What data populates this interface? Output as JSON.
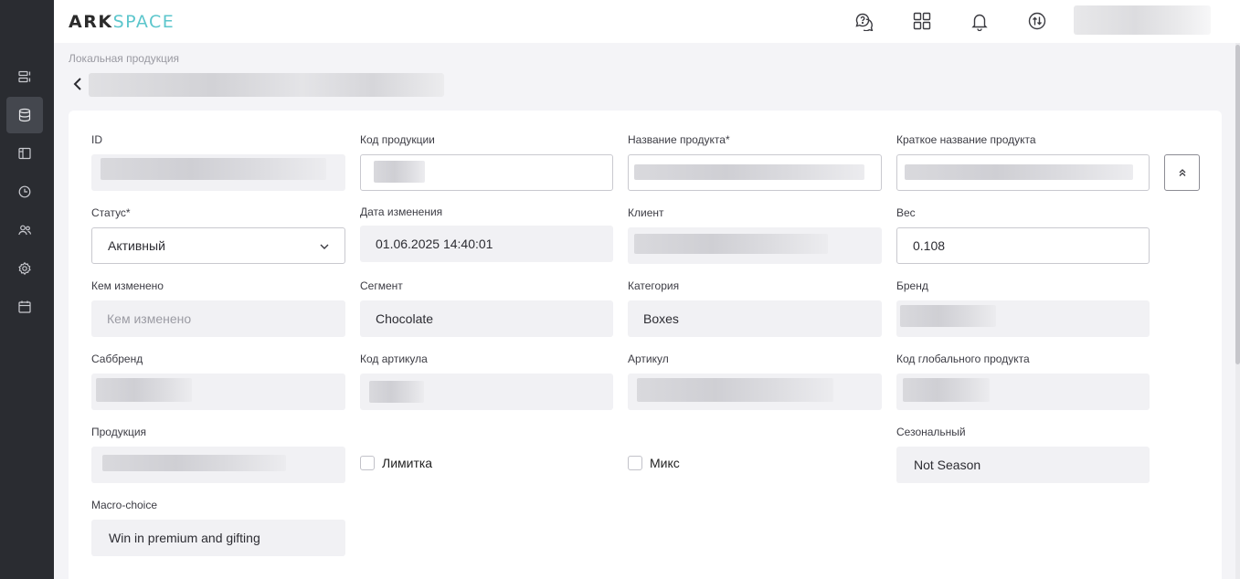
{
  "app": {
    "logo_bold": "ARK",
    "logo_light": "SPACE"
  },
  "nav": {
    "items": [
      {
        "icon": "list-icon"
      },
      {
        "icon": "database-icon",
        "active": true
      },
      {
        "icon": "layout-icon"
      },
      {
        "icon": "clock-icon"
      },
      {
        "icon": "users-icon"
      },
      {
        "icon": "gear-icon"
      },
      {
        "icon": "calendar-icon"
      }
    ]
  },
  "header": {
    "icons": [
      "help-chat-icon",
      "apps-grid-icon",
      "bell-icon",
      "sync-icon"
    ]
  },
  "breadcrumb": "Локальная продукция",
  "form": {
    "id": {
      "label": "ID"
    },
    "product_code": {
      "label": "Код продукции"
    },
    "product_name": {
      "label": "Название продукта*"
    },
    "short_name": {
      "label": "Краткое название продукта"
    },
    "status": {
      "label": "Статус*",
      "value": "Активный"
    },
    "changed_date": {
      "label": "Дата изменения",
      "value": "01.06.2025 14:40:01"
    },
    "client": {
      "label": "Клиент"
    },
    "weight": {
      "label": "Вес",
      "value": "0.108"
    },
    "changed_by": {
      "label": "Кем изменено",
      "placeholder": "Кем изменено"
    },
    "segment": {
      "label": "Сегмент",
      "value": "Chocolate"
    },
    "category": {
      "label": "Категория",
      "value": "Boxes"
    },
    "brand": {
      "label": "Бренд"
    },
    "subbrand": {
      "label": "Саббренд"
    },
    "article_code": {
      "label": "Код артикула"
    },
    "article": {
      "label": "Артикул"
    },
    "global_code": {
      "label": "Код глобального продукта"
    },
    "production": {
      "label": "Продукция"
    },
    "limited": {
      "label": "Лимитка",
      "checked": false
    },
    "mix": {
      "label": "Микс",
      "checked": false
    },
    "seasonal": {
      "label": "Сезональный",
      "value": "Not Season"
    },
    "macro_choice": {
      "label": "Macro-choice",
      "value": "Win in premium and gifting"
    }
  },
  "colors": {
    "sidebar": "#2a2c31",
    "accent": "#5cc6cc",
    "field_bg": "#f1f1f4"
  }
}
